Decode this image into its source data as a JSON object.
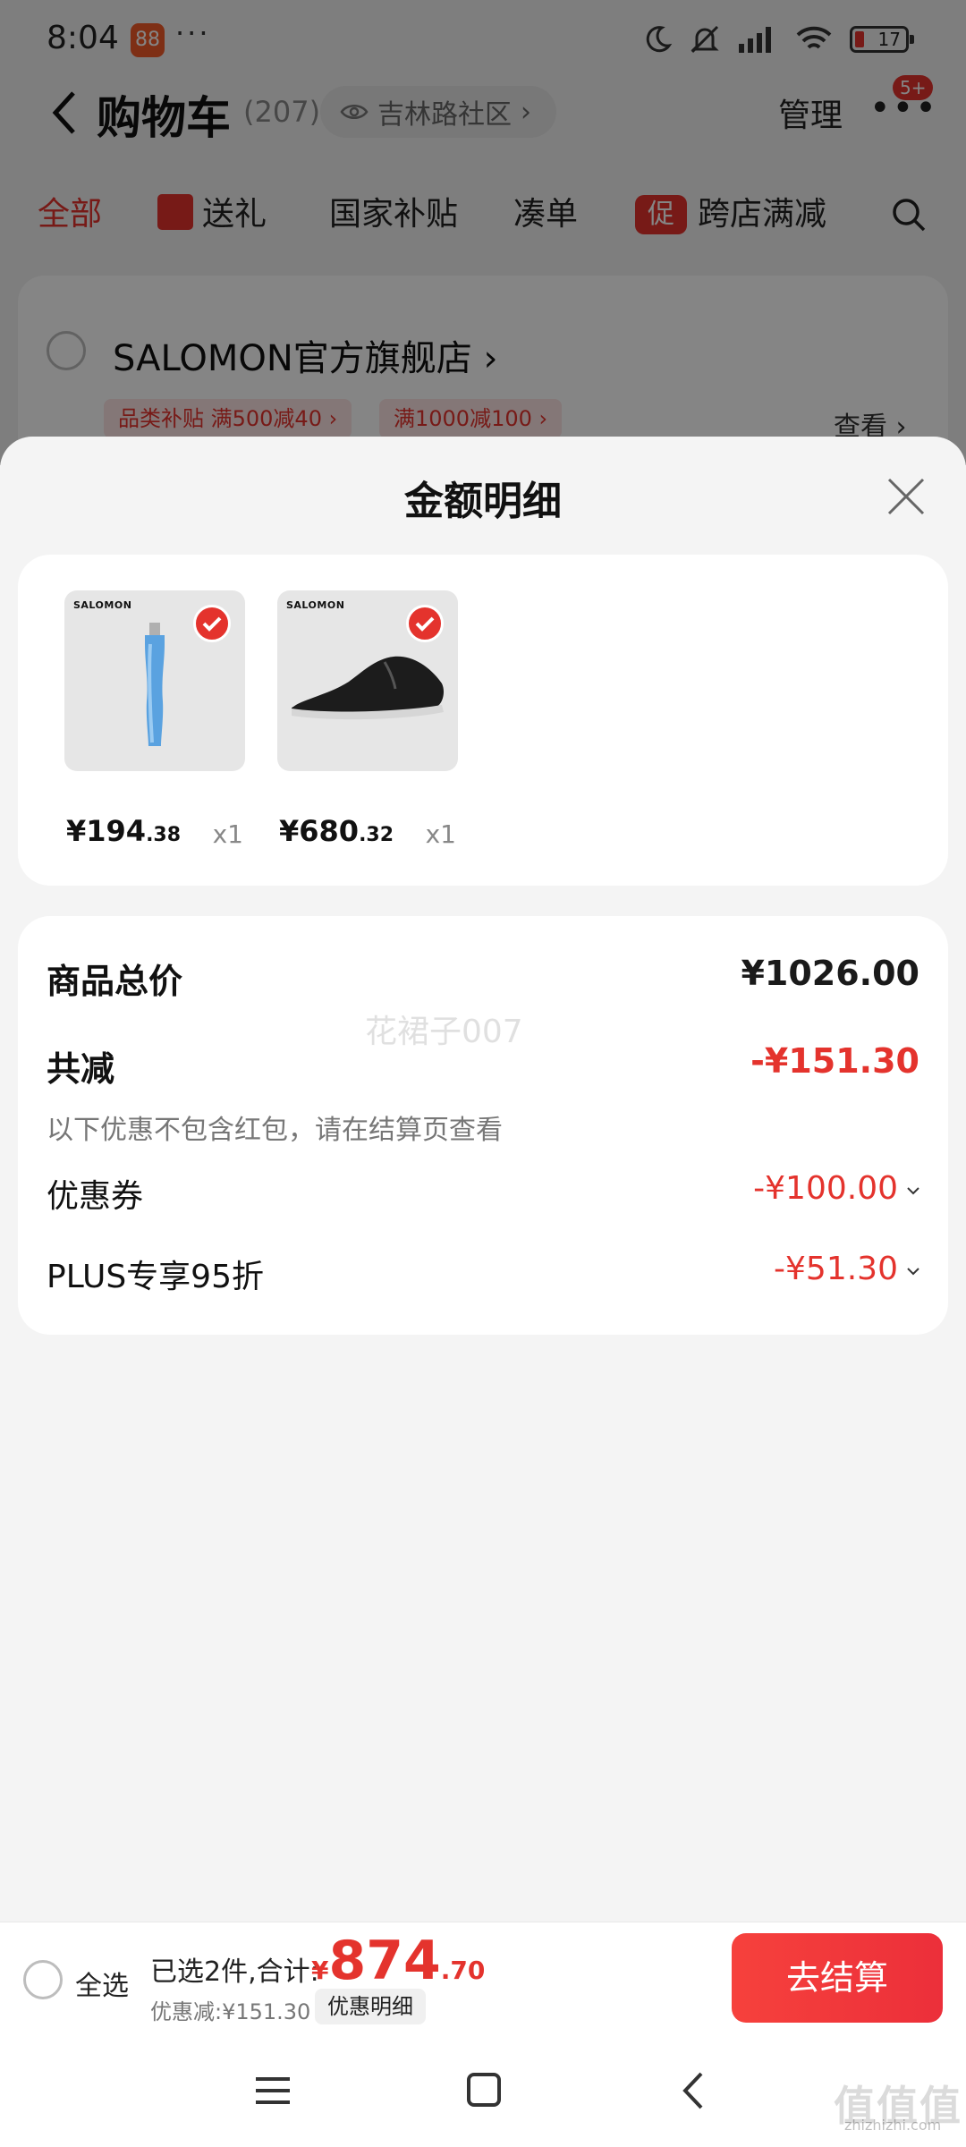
{
  "status_bar": {
    "time": "8:04",
    "more": "···",
    "battery": "17"
  },
  "header": {
    "title": "购物车",
    "count": "(207)",
    "location": "吉林路社区",
    "manage": "管理",
    "more": "•••",
    "badge": "5+"
  },
  "tabs": [
    {
      "label": "全部"
    },
    {
      "label": "送礼"
    },
    {
      "label": "国家补贴"
    },
    {
      "label": "凑单"
    },
    {
      "label": "跨店满减",
      "prefix": "促"
    }
  ],
  "store": {
    "name": "SALOMON官方旗舰店",
    "chips": [
      "品类补贴 满500减40 ›",
      "满1000减100 ›"
    ],
    "view": "查看 ›"
  },
  "sheet": {
    "title": "金额明细",
    "items": [
      {
        "brand": "SALOMON",
        "price_int": "¥194",
        "price_dec": ".38",
        "qty": "x1",
        "image": "soft-flask"
      },
      {
        "brand": "SALOMON",
        "price_int": "¥680",
        "price_dec": ".32",
        "qty": "x1",
        "image": "black-shoe"
      }
    ],
    "summary": {
      "total_label": "商品总价",
      "total_value": "¥1026.00",
      "reduce_label": "共减",
      "reduce_value": "-¥151.30",
      "hint": "以下优惠不包含红包，请在结算页查看",
      "coupon_label": "优惠券",
      "coupon_value": "-¥100.00",
      "plus_label": "PLUS专享95折",
      "plus_value": "-¥51.30"
    },
    "watermark": "花裙子007"
  },
  "checkout": {
    "select_all": "全选",
    "selected": "已选2件,合计:",
    "currency": "¥",
    "amount_int": "874",
    "amount_dec": ".70",
    "saved": "优惠减:¥151.30",
    "detail": "优惠明细",
    "pay": "去结算"
  },
  "site": {
    "mark": "值值值",
    "url": "zhizhizhi.com"
  },
  "colors": {
    "accent": "#e4332d",
    "sheet_bg": "#f4f4f4"
  }
}
